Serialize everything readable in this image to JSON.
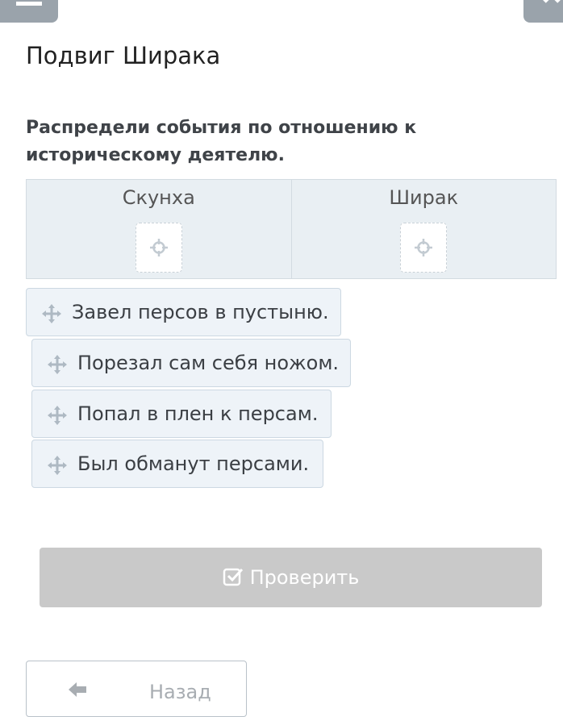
{
  "header": {
    "menu_icon": "menu-icon",
    "close_icon": "close-icon"
  },
  "title": "Подвиг Ширака",
  "instruction": "Распредели события по отношению к историческому деятелю.",
  "columns": [
    {
      "label": "Скунха",
      "drop_icon": "crosshair-icon"
    },
    {
      "label": "Ширак",
      "drop_icon": "crosshair-icon"
    }
  ],
  "cards": [
    {
      "text": "Завел персов в пустыню.",
      "icon": "move-icon"
    },
    {
      "text": "Порезал сам себя ножом.",
      "icon": "move-icon"
    },
    {
      "text": "Попал в плен к персам.",
      "icon": "move-icon"
    },
    {
      "text": "Был обманут персами.",
      "icon": "move-icon"
    }
  ],
  "check_button": {
    "label": "Проверить",
    "icon": "check-square-icon",
    "state": "disabled"
  },
  "back_button": {
    "label": "Назад",
    "icon": "arrow-left-icon"
  },
  "colors": {
    "column_bg": "#e9eff3",
    "card_bg": "#eef3f8",
    "disabled_button": "#c9c9c9",
    "header_button": "#9aa3ab"
  }
}
